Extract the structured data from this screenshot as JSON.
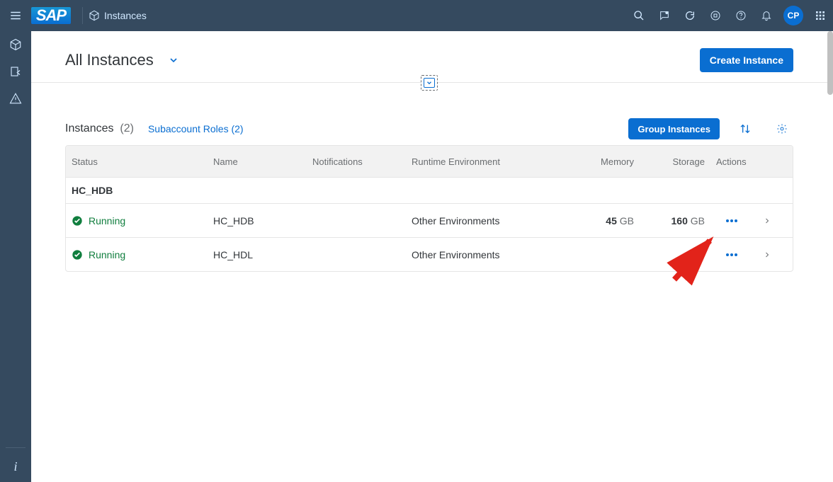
{
  "shellbar": {
    "logo_text": "SAP",
    "breadcrumb_label": "Instances",
    "avatar_initials": "CP"
  },
  "page": {
    "title": "All Instances",
    "create_button": "Create Instance"
  },
  "toolbar": {
    "heading": "Instances",
    "count_display": "(2)",
    "subaccount_link": "Subaccount Roles (2)",
    "group_button": "Group Instances"
  },
  "columns": {
    "status": "Status",
    "name": "Name",
    "notifications": "Notifications",
    "runtime": "Runtime Environment",
    "memory": "Memory",
    "storage": "Storage",
    "actions": "Actions"
  },
  "group_label": "HC_HDB",
  "rows": [
    {
      "status": "Running",
      "name": "HC_HDB",
      "notifications": "",
      "runtime": "Other Environments",
      "memory_value": "45",
      "memory_unit": " GB",
      "storage_value": "160",
      "storage_unit": " GB"
    },
    {
      "status": "Running",
      "name": "HC_HDL",
      "notifications": "",
      "runtime": "Other Environments",
      "memory_value": "",
      "memory_unit": "",
      "storage_value": "",
      "storage_unit": ""
    }
  ]
}
